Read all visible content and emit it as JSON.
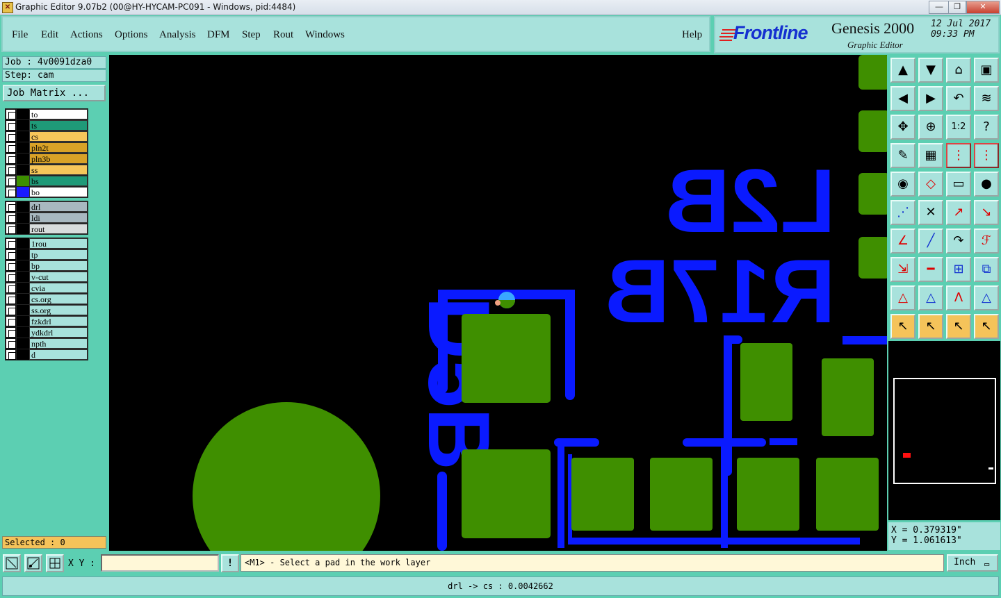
{
  "window": {
    "title": "Graphic Editor 9.07b2 (00@HY-HYCAM-PC091 - Windows, pid:4484)",
    "minimize_glyph": "—",
    "maximize_glyph": "❐",
    "close_glyph": "✕"
  },
  "menu": {
    "file": "File",
    "edit": "Edit",
    "actions": "Actions",
    "options": "Options",
    "analysis": "Analysis",
    "dfm": "DFM",
    "step": "Step",
    "rout": "Rout",
    "windows": "Windows",
    "help": "Help"
  },
  "brand": {
    "logo": "Frontline",
    "product": "Genesis 2000",
    "subtitle": "Graphic Editor",
    "date": "12 Jul 2017",
    "time": "09:33 PM"
  },
  "left_panel": {
    "job": "Job : 4v0091dza0",
    "step": "Step: cam",
    "job_matrix": "Job Matrix ..."
  },
  "layers_group1": [
    {
      "name": "to",
      "color": "#ffffff",
      "swatch": "#000000"
    },
    {
      "name": "ts",
      "color": "#1f9a78",
      "swatch": "#000000"
    },
    {
      "name": "cs",
      "color": "#f7c65a",
      "swatch": "#000000"
    },
    {
      "name": "pln2t",
      "color": "#d9a227",
      "swatch": "#000000"
    },
    {
      "name": "pln3b",
      "color": "#d9a227",
      "swatch": "#000000"
    },
    {
      "name": "ss",
      "color": "#f7c65a",
      "swatch": "#000000"
    },
    {
      "name": "bs",
      "color": "#1f9a78",
      "swatch": "#3d8f00"
    },
    {
      "name": "bo",
      "color": "#ffffff",
      "swatch": "#1a1aff"
    }
  ],
  "layers_group2": [
    {
      "name": "drl",
      "color": "#a8b8c0"
    },
    {
      "name": "ldi",
      "color": "#a8b8c0"
    },
    {
      "name": "rout",
      "color": "#d8dcdc"
    }
  ],
  "layers_group3": [
    {
      "name": "1rou"
    },
    {
      "name": "tp"
    },
    {
      "name": "bp"
    },
    {
      "name": "v-cut"
    },
    {
      "name": "cvia"
    },
    {
      "name": "cs.org"
    },
    {
      "name": "ss.org"
    },
    {
      "name": "fzkdrl"
    },
    {
      "name": "ydkdrl"
    },
    {
      "name": "npth"
    },
    {
      "name": "d"
    }
  ],
  "selected_text": "Selected : 0",
  "canvas_labels": {
    "l2b": "L2B",
    "r17b": "R17B",
    "d5b": "D5B"
  },
  "coords": {
    "x": "X = 0.379319\"",
    "y": "Y = 1.061613\""
  },
  "bottom": {
    "xy_label": "X Y :",
    "xy_value": "",
    "excl": "!",
    "prompt": "<M1> - Select a pad in the work layer",
    "unit": "Inch",
    "status": "drl -> cs : 0.0042662"
  },
  "tool_icons": [
    "open-job-icon",
    "close-job-icon",
    "home-icon",
    "window-icon",
    "prev-icon",
    "next-icon",
    "undo-zoom-icon",
    "toggle-icon",
    "fit-icon",
    "zoom-icon",
    "scale-1-2-icon",
    "help-icon",
    "pen-tool-icon",
    "grid-icon",
    "layers-red-icon",
    "layers-red2-icon",
    "pad-icon",
    "select-shape-icon",
    "ruler-icon",
    "dot-icon",
    "connect-icon",
    "cross-icon",
    "move-icon",
    "move2-icon",
    "line-icon",
    "line2-icon",
    "arc-icon",
    "text-icon",
    "resize-icon",
    "minus-icon",
    "array-icon",
    "copy-icon",
    "triangle-icon",
    "triangle2-icon",
    "triangle3-icon",
    "triangle4-icon",
    "pointer-icon",
    "select-box-icon",
    "select-circle-icon",
    "select-path-icon"
  ]
}
